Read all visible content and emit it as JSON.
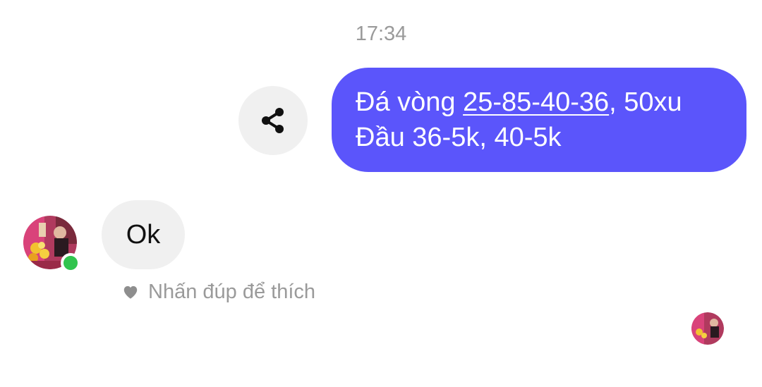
{
  "thread": {
    "timestamp": "17:34"
  },
  "outgoing_message": {
    "line1_prefix": "Đá vòng ",
    "line1_link": "25-85-40-36",
    "line1_suffix": ", 50xu",
    "line2": "Đầu 36-5k, 40-5k",
    "bubble_color": "#5b55fb"
  },
  "share_button": {
    "icon": "share-icon"
  },
  "incoming_message": {
    "text": "Ok",
    "bubble_color": "#f0f0f0"
  },
  "contact": {
    "avatar_icon": "avatar",
    "online": true,
    "online_color": "#31c44e"
  },
  "like_hint": {
    "icon": "heart-icon",
    "text": "Nhấn đúp để thích"
  },
  "seen_receipt": {
    "avatar_icon": "seen-avatar"
  }
}
